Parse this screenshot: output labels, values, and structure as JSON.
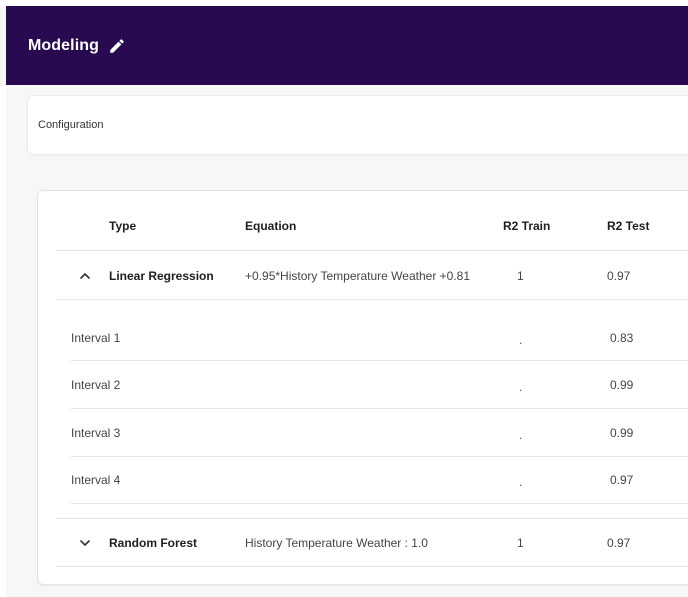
{
  "header": {
    "title": "Modeling",
    "edit_icon": "pencil-icon",
    "color": "#270a50"
  },
  "configuration": {
    "label": "Configuration"
  },
  "table": {
    "columns": [
      "Type",
      "Equation",
      "R2 Train",
      "R2 Test"
    ],
    "models": [
      {
        "type": "Linear Regression",
        "expanded": true,
        "toggle_icon": "chevron-up-icon",
        "equation": "+0.95*History Temperature Weather +0.81",
        "r2_train": "1",
        "r2_test": "0.97",
        "intervals": [
          {
            "label": "Interval 1",
            "r2_train": ".",
            "r2_test": "0.83"
          },
          {
            "label": "Interval 2",
            "r2_train": ".",
            "r2_test": "0.99"
          },
          {
            "label": "Interval 3",
            "r2_train": ".",
            "r2_test": "0.99"
          },
          {
            "label": "Interval 4",
            "r2_train": ".",
            "r2_test": "0.97"
          }
        ]
      },
      {
        "type": "Random Forest",
        "expanded": false,
        "toggle_icon": "chevron-down-icon",
        "equation": "History Temperature Weather : 1.0",
        "r2_train": "1",
        "r2_test": "0.97"
      }
    ]
  }
}
